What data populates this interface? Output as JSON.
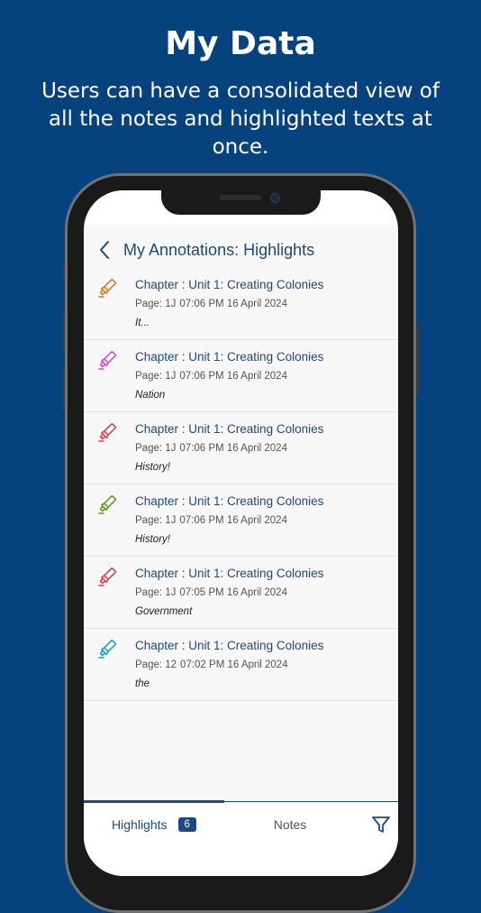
{
  "promo": {
    "title": "My Data",
    "subtitle": "Users can have a consolidated view of all the notes and highlighted texts at once."
  },
  "header": {
    "title": "My Annotations: Highlights",
    "back_icon": "chevron-left-icon"
  },
  "highlights": [
    {
      "chapter": "Chapter : Unit 1: Creating Colonies",
      "page": "Page: 1J",
      "timestamp": "07:06 PM 16 April 2024",
      "text": "It...",
      "color": "#d97a1a",
      "icon": "highlighter-icon"
    },
    {
      "chapter": "Chapter : Unit 1: Creating Colonies",
      "page": "Page: 1J",
      "timestamp": "07:06 PM 16 April 2024",
      "text": "Nation",
      "color": "#c64fd8",
      "icon": "highlighter-icon"
    },
    {
      "chapter": "Chapter : Unit 1: Creating Colonies",
      "page": "Page: 1J",
      "timestamp": "07:06 PM 16 April 2024",
      "text": "History!",
      "color": "#e0404a",
      "icon": "highlighter-icon"
    },
    {
      "chapter": "Chapter : Unit 1: Creating Colonies",
      "page": "Page: 1J",
      "timestamp": "07:06 PM 16 April 2024",
      "text": "History!",
      "color": "#5c9a22",
      "icon": "highlighter-icon"
    },
    {
      "chapter": "Chapter : Unit 1: Creating Colonies",
      "page": "Page: 1J",
      "timestamp": "07:05 PM 16 April 2024",
      "text": "Government",
      "color": "#e0404a",
      "icon": "highlighter-icon"
    },
    {
      "chapter": "Chapter : Unit 1: Creating Colonies",
      "page": "Page: 12",
      "timestamp": "07:02 PM 16 April 2024",
      "text": "the",
      "color": "#1e9ad6",
      "icon": "highlighter-icon"
    }
  ],
  "tabs": {
    "highlights_label": "Highlights",
    "highlights_count": "6",
    "notes_label": "Notes",
    "filter_icon": "filter-icon"
  },
  "colors": {
    "background": "#06437e",
    "accent": "#1b4a7e"
  }
}
